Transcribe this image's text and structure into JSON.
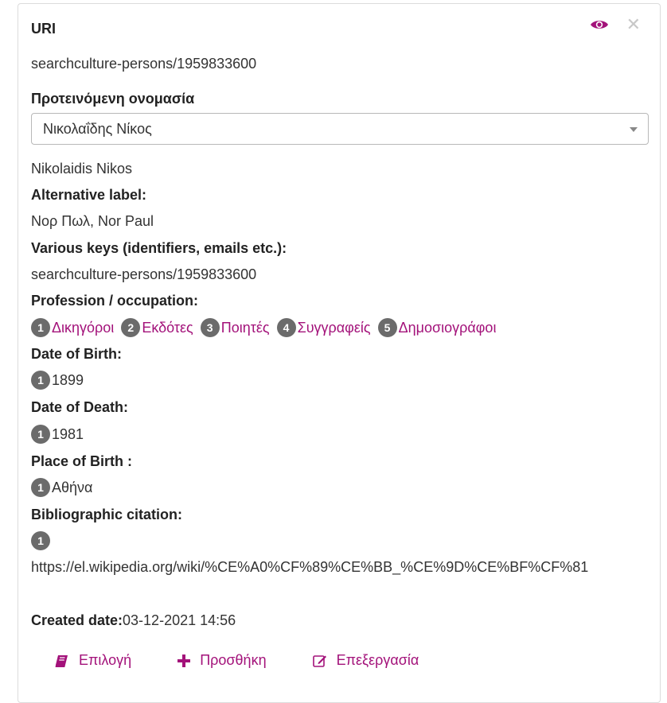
{
  "card": {
    "uri_label": "URI",
    "uri_value": "searchculture-persons/1959833600",
    "preferred_label": "Προτεινόμενη ονομασία",
    "preferred_select_value": "Νικολαΐδης Νίκος",
    "name_latin": "Nikolaidis Nikos",
    "alt_label_heading": "Alternative label:",
    "alt_label_value": "Νορ Πωλ, Nor Paul",
    "keys_heading": "Various keys (identifiers, emails etc.):",
    "keys_value": "searchculture-persons/1959833600",
    "profession_heading": "Profession / occupation:",
    "professions": [
      {
        "num": "1",
        "label": "Δικηγόροι"
      },
      {
        "num": "2",
        "label": "Εκδότες"
      },
      {
        "num": "3",
        "label": "Ποιητές"
      },
      {
        "num": "4",
        "label": "Συγγραφείς"
      },
      {
        "num": "5",
        "label": "Δημοσιογράφοι"
      }
    ],
    "birth_heading": "Date of Birth:",
    "birth_num": "1",
    "birth_value": "1899",
    "death_heading": "Date of Death:",
    "death_num": "1",
    "death_value": "1981",
    "place_heading": "Place of Birth :",
    "place_num": "1",
    "place_value": "Αθήνα",
    "citation_heading": "Bibliographic citation:",
    "citation_num": "1",
    "citation_value": "https://el.wikipedia.org/wiki/%CE%A0%CF%89%CE%BB_%CE%9D%CE%BF%CF%81",
    "created_label": "Created date:",
    "created_value": "03-12-2021 14:56"
  },
  "actions": {
    "select_label": "Επιλογή",
    "add_label": "Προσθήκη",
    "edit_label": "Επεξεργασία"
  },
  "icons": [
    "eye-icon",
    "close-icon",
    "book-icon",
    "plus-icon",
    "edit-icon"
  ],
  "colors": {
    "accent": "#a3127a",
    "badge": "#6b6b6b",
    "close": "#c8c8c8"
  }
}
